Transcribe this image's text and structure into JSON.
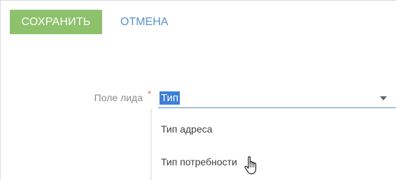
{
  "toolbar": {
    "save_label": "СОХРАНИТЬ",
    "cancel_label": "ОТМЕНА"
  },
  "form": {
    "field_label": "Поле лида",
    "required_mark": "*",
    "select_value": "Тип"
  },
  "dropdown": {
    "items": [
      {
        "label": "Тип адреса"
      },
      {
        "label": "Тип потребности"
      }
    ]
  },
  "colors": {
    "save_button": "#8dc16b",
    "link": "#5a8fcf",
    "selection": "#3d80d6",
    "required": "#e2614a"
  },
  "icons": {
    "caret": "chevron-down-icon",
    "cursor": "hand-pointer-icon"
  }
}
